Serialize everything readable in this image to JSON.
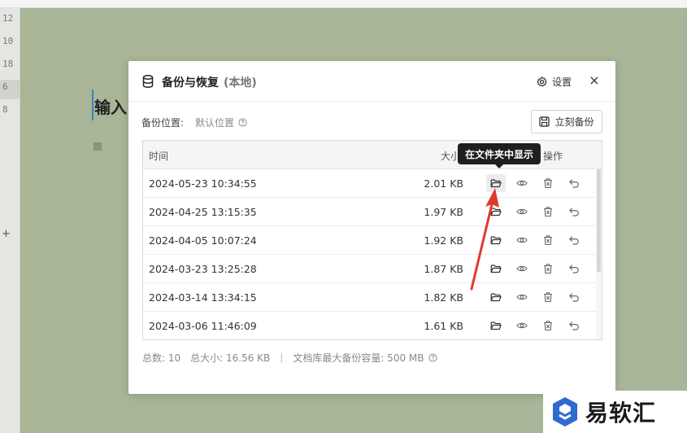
{
  "editor": {
    "line_numbers": [
      "12",
      "10",
      "18",
      "6",
      "8"
    ],
    "heading_text": "输入"
  },
  "dialog": {
    "title": "备份与恢复",
    "subtitle": "(本地)",
    "settings_label": "设置",
    "close_label": "×",
    "location_label": "备份位置:",
    "location_value": "默认位置",
    "backup_button_label": "立刻备份",
    "table": {
      "headers": {
        "time": "时间",
        "size": "大小",
        "ops": "操作"
      },
      "rows": [
        {
          "time": "2024-05-23 10:34:55",
          "size": "2.01 KB"
        },
        {
          "time": "2024-04-25 13:15:35",
          "size": "1.97 KB"
        },
        {
          "time": "2024-04-05 10:07:24",
          "size": "1.92 KB"
        },
        {
          "time": "2024-03-23 13:25:28",
          "size": "1.87 KB"
        },
        {
          "time": "2024-03-14 13:34:15",
          "size": "1.82 KB"
        },
        {
          "time": "2024-03-06 11:46:09",
          "size": "1.61 KB"
        }
      ],
      "row_actions": [
        "folder-open-icon",
        "eye-icon",
        "trash-icon",
        "undo-icon"
      ]
    },
    "footer": {
      "count": "总数: 10",
      "total_size": "总大小: 16.56 KB",
      "separator": "|",
      "capacity": "文档库最大备份容量: 500 MB"
    }
  },
  "tooltip": {
    "text": "在文件夹中显示"
  },
  "watermark": {
    "text": "易软汇"
  },
  "colors": {
    "background": "#a8b596",
    "tooltip": "#1f1f1f",
    "arrow": "#e03a2e",
    "logo": "#2f6ad0"
  }
}
